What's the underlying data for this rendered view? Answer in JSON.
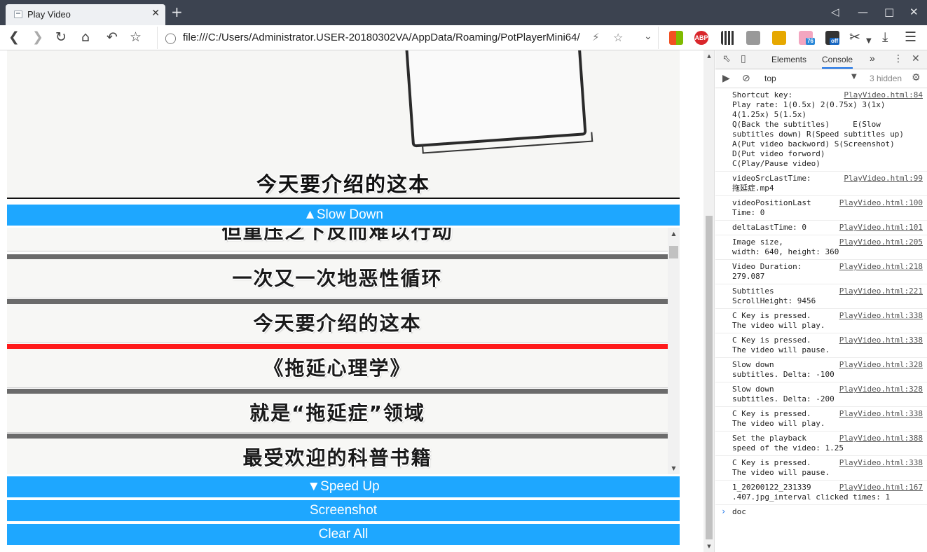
{
  "browser": {
    "tab_title": "Play Video",
    "tab_close": "✕",
    "new_tab": "+",
    "address": "file:///C:/Users/Administrator.USER-20180302VA/AppData/Roaming/PotPlayerMini64/"
  },
  "toolbar_icons": [
    "back-icon",
    "forward-icon",
    "reload-icon",
    "home-icon",
    "undo-icon",
    "bookmark-star-icon"
  ],
  "extensions": [
    {
      "name": "windows-extension-icon",
      "color": "#f25022"
    },
    {
      "name": "adblock-plus-icon",
      "label": "ABP",
      "color": "#d9262b"
    },
    {
      "name": "qr-code-icon",
      "color": "#333333"
    },
    {
      "name": "eraser-icon",
      "color": "#888888"
    },
    {
      "name": "tampermonkey-icon",
      "color": "#e6a800"
    },
    {
      "name": "cat-extension-icon",
      "label": "76",
      "color": "#2b88d8"
    },
    {
      "name": "ei-off-icon",
      "label": "off",
      "color": "#1565c0"
    },
    {
      "name": "scissors-icon",
      "color": "#444444"
    }
  ],
  "video": {
    "subtitle": "今天要介绍的这本"
  },
  "buttons": {
    "slow_down": "▲Slow Down",
    "speed_up": "▼Speed Up",
    "screenshot": "Screenshot",
    "clear_all": "Clear All"
  },
  "subtitles": [
    {
      "text": "但重压之下反而难以行动",
      "active": false
    },
    {
      "text": "一次又一次地恶性循环",
      "active": false
    },
    {
      "text": "今天要介绍的这本",
      "active": false
    },
    {
      "text": "《拖延心理学》",
      "active": true
    },
    {
      "text": "就是“拖延症”领域",
      "active": false
    },
    {
      "text": "最受欢迎的科普书籍",
      "active": false
    }
  ],
  "devtools": {
    "tabs": [
      "Elements",
      "Console"
    ],
    "active_tab": "Console",
    "more": "»",
    "context": "top",
    "hidden": "3 hidden",
    "prompt_text": "doc",
    "messages": [
      {
        "text": "Shortcut key:\nPlay rate: 1(0.5x) 2(0.75x) 3(1x) 4(1.25x) 5(1.5x)\nQ(Back the subtitles)     E(Slow subtitles down) R(Speed subtitles up)\nA(Put video backword) S(Screenshot)\nD(Put video forword)\nC(Play/Pause video)",
        "src": "PlayVideo.html:84"
      },
      {
        "text": "videoSrcLastTime:\n拖延症.mp4",
        "src": "PlayVideo.html:99"
      },
      {
        "text": "videoPositionLast\nTime: 0",
        "src": "PlayVideo.html:100"
      },
      {
        "text": "deltaLastTime: 0",
        "src": "PlayVideo.html:101"
      },
      {
        "text": "Image size,\nwidth: 640, height: 360",
        "src": "PlayVideo.html:205"
      },
      {
        "text": "Video Duration:\n279.087",
        "src": "PlayVideo.html:218"
      },
      {
        "text": "Subtitles\nScrollHeight: 9456",
        "src": "PlayVideo.html:221"
      },
      {
        "text": "C Key is pressed.\nThe video will play.",
        "src": "PlayVideo.html:338"
      },
      {
        "text": "C Key is pressed.\nThe video will pause.",
        "src": "PlayVideo.html:338"
      },
      {
        "text": "Slow down\nsubtitles. Delta: -100",
        "src": "PlayVideo.html:328"
      },
      {
        "text": "Slow down\nsubtitles. Delta: -200",
        "src": "PlayVideo.html:328"
      },
      {
        "text": "C Key is pressed.\nThe video will play.",
        "src": "PlayVideo.html:338"
      },
      {
        "text": "Set the playback\nspeed of the video: 1.25",
        "src": "PlayVideo.html:388"
      },
      {
        "text": "C Key is pressed.\nThe video will pause.",
        "src": "PlayVideo.html:338"
      },
      {
        "text": "1_20200122_231339\n.407.jpg_interval clicked times: 1",
        "src": "PlayVideo.html:167"
      }
    ]
  }
}
